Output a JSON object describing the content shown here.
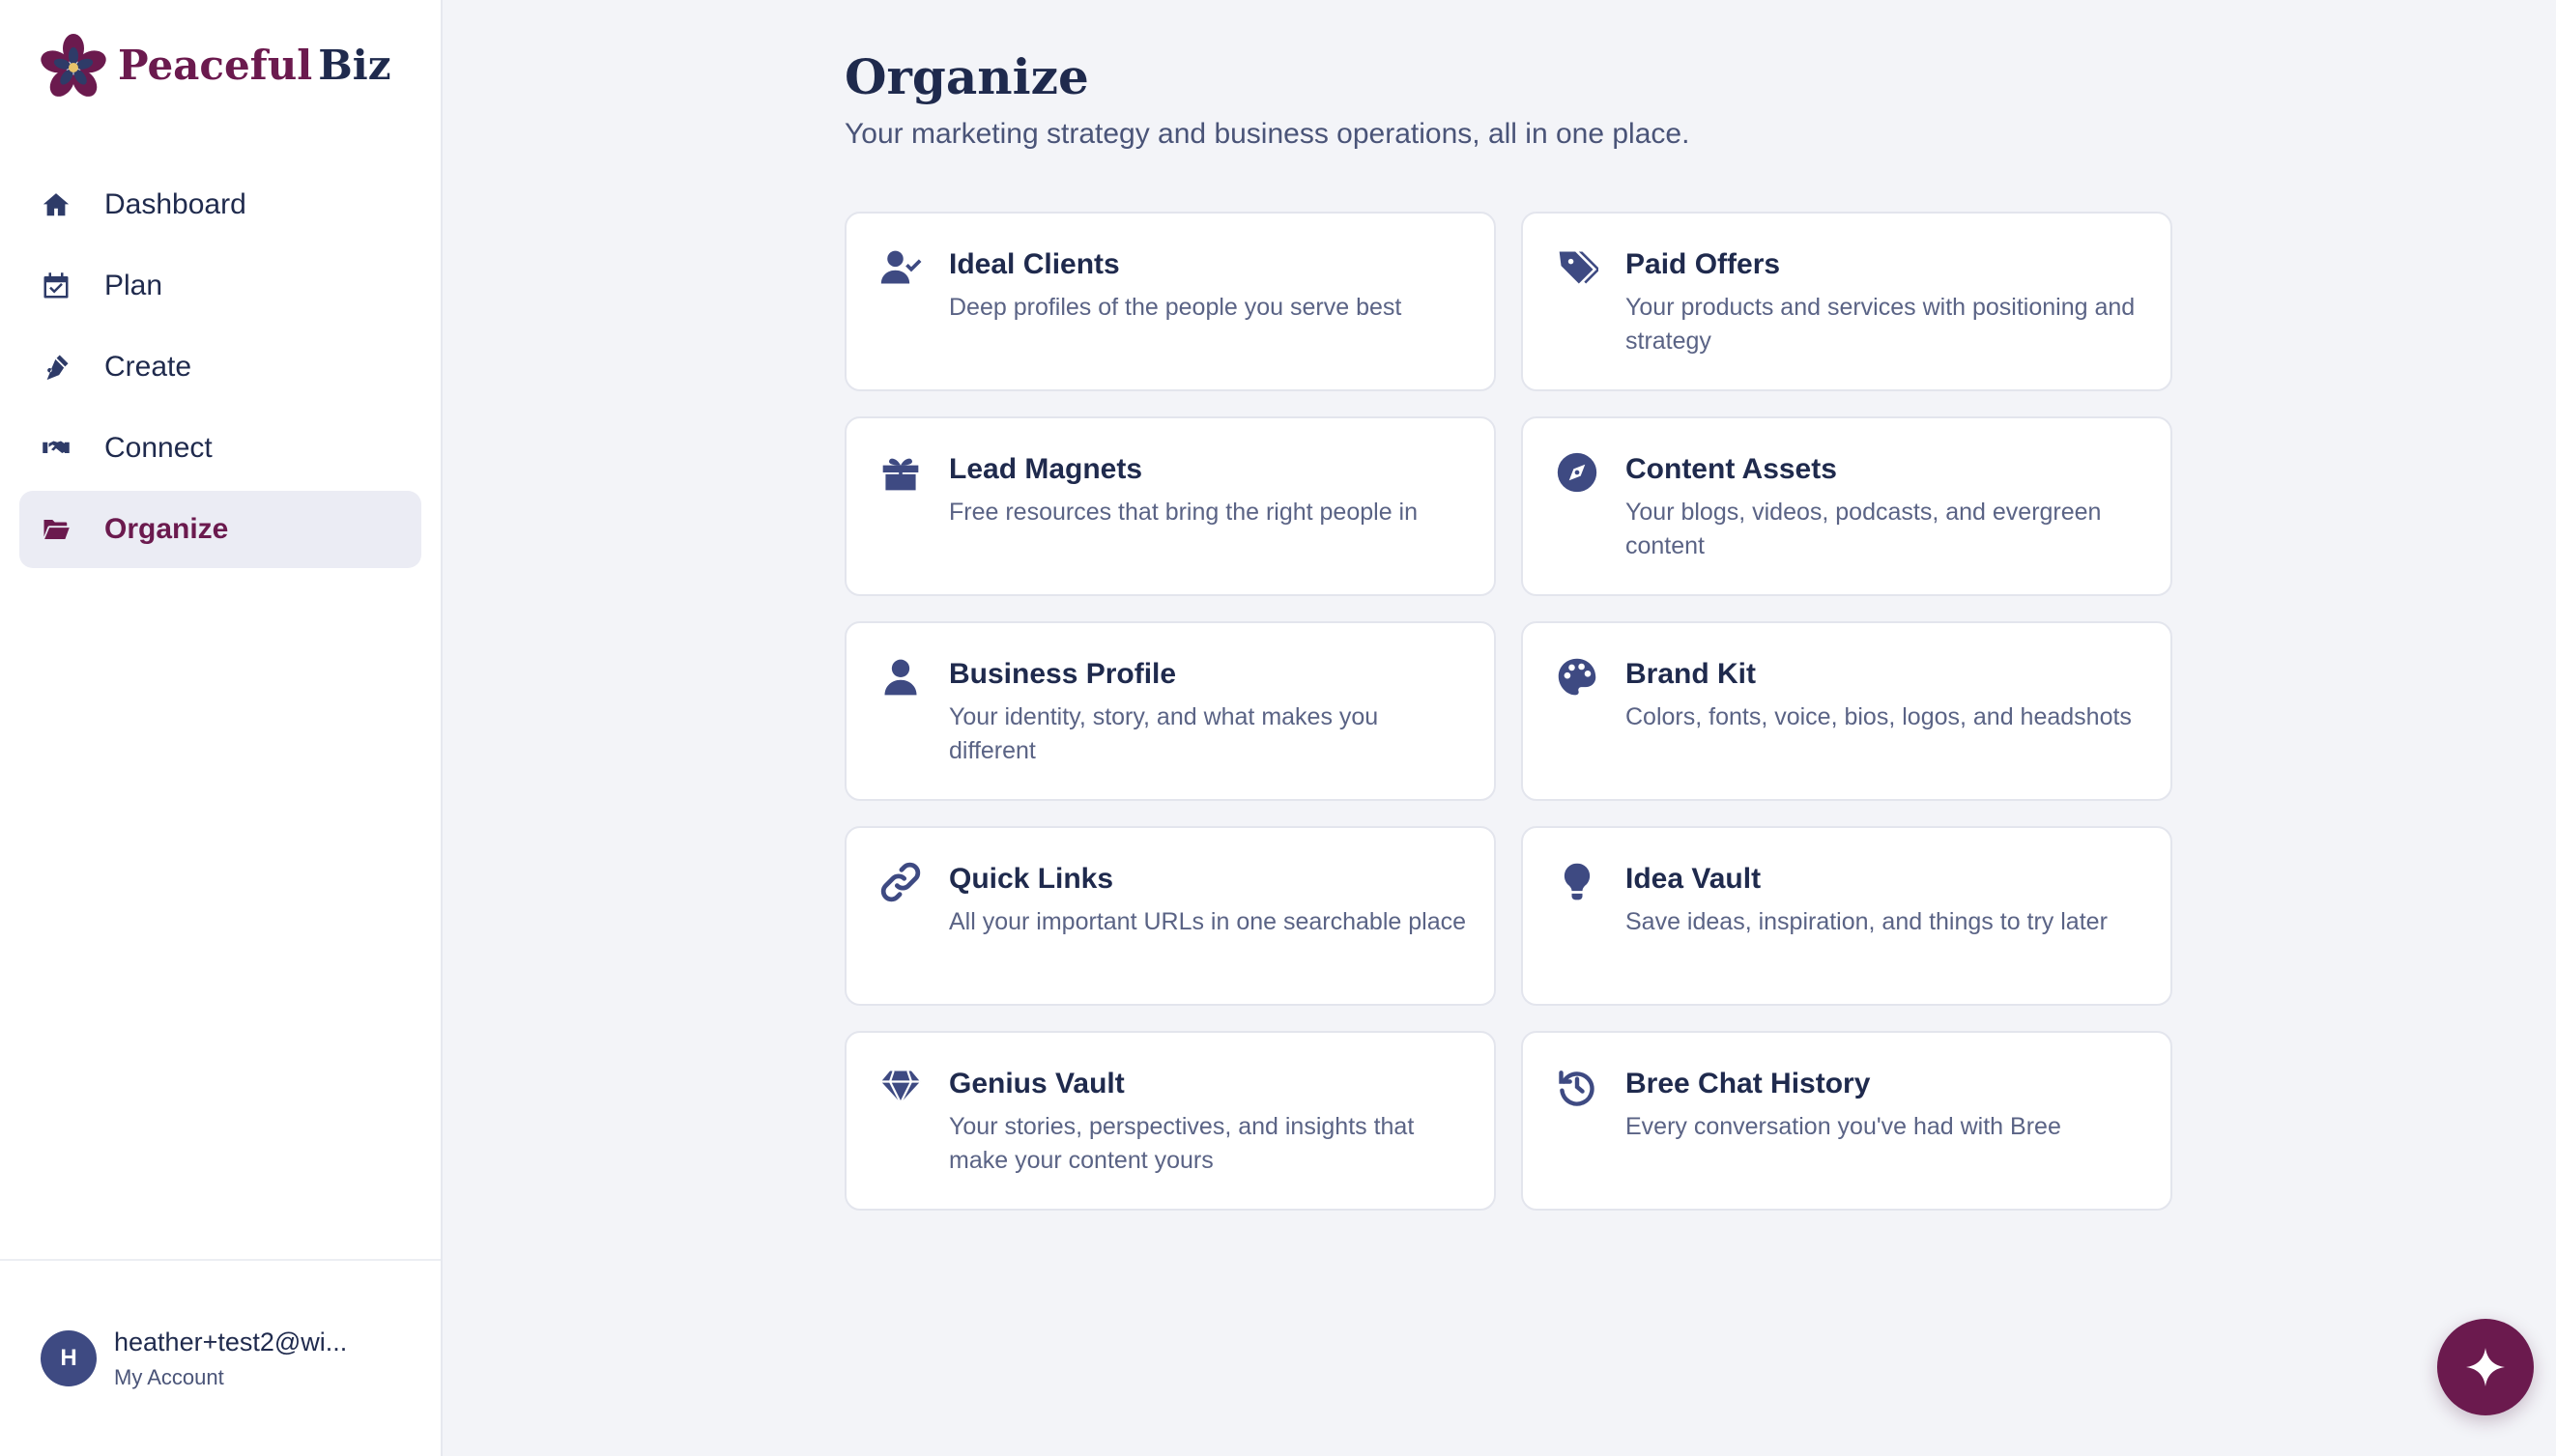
{
  "brand": {
    "name_part1": "Peaceful",
    "name_part2": "Biz",
    "accent": "#6b1a4e",
    "navy": "#1f2a4d"
  },
  "nav": {
    "items": [
      {
        "label": "Dashboard",
        "icon": "home-icon",
        "active": false
      },
      {
        "label": "Plan",
        "icon": "calendar-check-icon",
        "active": false
      },
      {
        "label": "Create",
        "icon": "pen-nib-icon",
        "active": false
      },
      {
        "label": "Connect",
        "icon": "handshake-icon",
        "active": false
      },
      {
        "label": "Organize",
        "icon": "folder-open-icon",
        "active": true
      }
    ]
  },
  "account": {
    "avatar_initial": "H",
    "email": "heather+test2@wi...",
    "link_label": "My Account"
  },
  "page": {
    "title": "Organize",
    "subtitle": "Your marketing strategy and business operations, all in one place."
  },
  "cards": [
    {
      "title": "Ideal Clients",
      "description": "Deep profiles of the people you serve best",
      "icon": "user-check-icon"
    },
    {
      "title": "Paid Offers",
      "description": "Your products and services with positioning and strategy",
      "icon": "tags-icon"
    },
    {
      "title": "Lead Magnets",
      "description": "Free resources that bring the right people in",
      "icon": "gift-icon"
    },
    {
      "title": "Content Assets",
      "description": "Your blogs, videos, podcasts, and evergreen content",
      "icon": "compass-icon"
    },
    {
      "title": "Business Profile",
      "description": "Your identity, story, and what makes you different",
      "icon": "user-icon"
    },
    {
      "title": "Brand Kit",
      "description": "Colors, fonts, voice, bios, logos, and headshots",
      "icon": "palette-icon"
    },
    {
      "title": "Quick Links",
      "description": "All your important URLs in one searchable place",
      "icon": "link-icon"
    },
    {
      "title": "Idea Vault",
      "description": "Save ideas, inspiration, and things to try later",
      "icon": "lightbulb-icon"
    },
    {
      "title": "Genius Vault",
      "description": "Your stories, perspectives, and insights that make your content yours",
      "icon": "gem-icon"
    },
    {
      "title": "Bree Chat History",
      "description": "Every conversation you've had with Bree",
      "icon": "history-icon"
    }
  ],
  "fab": {
    "icon": "sparkle-icon"
  }
}
